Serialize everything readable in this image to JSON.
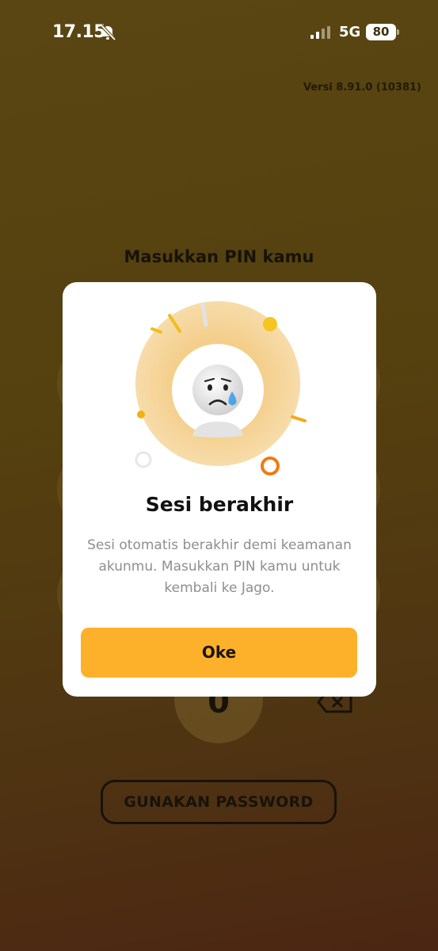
{
  "status_bar": {
    "time": "17.15",
    "network": "5G",
    "battery": "80",
    "icons": [
      "bell-off-icon",
      "signal-icon",
      "battery-icon"
    ]
  },
  "version": "Versi 8.91.0 (10381)",
  "pin_screen": {
    "title": "Masukkan PIN kamu",
    "zero_key": "0",
    "backspace_icon": "backspace-icon",
    "password_button": "GUNAKAN PASSWORD"
  },
  "modal": {
    "title": "Sesi berakhir",
    "description": "Sesi otomatis berakhir demi keamanan akunmu. Masukkan PIN kamu untuk kembali ke Jago.",
    "ok_button": "Oke",
    "illustration_icon": "crying-face-icon"
  },
  "colors": {
    "accent": "#fdb12a",
    "background": "#55410f",
    "modal_bg": "#ffffff",
    "description_text": "#8e8e8e"
  }
}
